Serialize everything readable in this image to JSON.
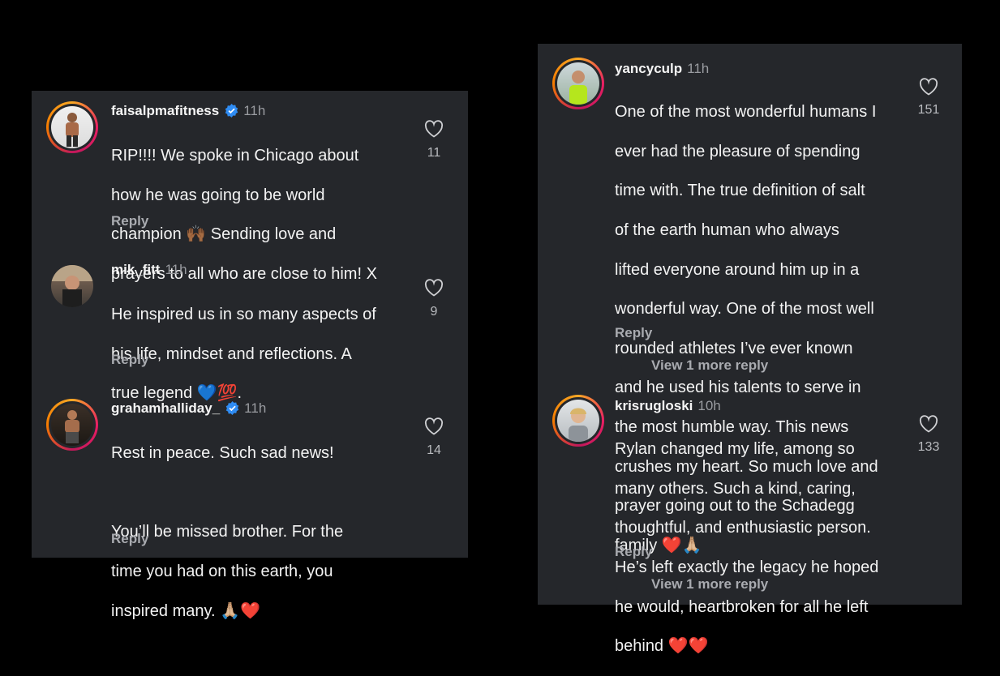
{
  "left_panel": {
    "comments": [
      {
        "username": "faisalpmafitness",
        "verified": true,
        "time": "11h",
        "lines": [
          "RIP!!!! We spoke in Chicago about",
          "how he was going to be world",
          "champion 🙌🏾 Sending love and",
          "prayers to all who are close to him! X"
        ],
        "reply": "Reply",
        "likes": "11"
      },
      {
        "username": "mik_fitt",
        "verified": false,
        "time": "11h",
        "lines": [
          "He inspired us in so many aspects of",
          "his life, mindset and reflections. A",
          "true legend 💙💯."
        ],
        "reply": "Reply",
        "likes": "9"
      },
      {
        "username": "grahamhalliday_",
        "verified": true,
        "time": "11h",
        "lines": [
          "Rest in peace. Such sad news!",
          "",
          "You’ll be missed brother. For the",
          "time you had on this earth, you",
          "inspired many. 🙏🏼❤️"
        ],
        "reply": "Reply",
        "likes": "14"
      }
    ]
  },
  "right_panel": {
    "comments": [
      {
        "username": "yancyculp",
        "verified": false,
        "time": "11h",
        "lines": [
          "One of the most wonderful humans I",
          "ever had the pleasure of spending",
          "time with.  The true definition of salt",
          "of the earth human who always",
          "lifted everyone around him up in a",
          "wonderful way.  One of the most well",
          "rounded athletes I’ve ever known",
          "and he used his talents to serve in",
          "the most humble way.  This news",
          "crushes my heart.  So much love and",
          "prayer going out to the Schadegg",
          "family ❤️🙏🏼"
        ],
        "reply": "Reply",
        "view_more": "View 1 more reply",
        "likes": "151"
      },
      {
        "username": "krisrugloski",
        "verified": false,
        "time": "10h",
        "lines": [
          "Rylan changed my life, among so",
          "many others. Such a kind, caring,",
          "thoughtful, and enthusiastic person.",
          "He’s left exactly the legacy he hoped",
          "he would, heartbroken for all he left",
          "behind ❤️❤️"
        ],
        "reply": "Reply",
        "view_more": "View 1 more reply",
        "likes": "133"
      }
    ]
  },
  "icons": {
    "like": "heart-outline-icon",
    "verified": "verified-badge-icon"
  },
  "colors": {
    "panel_bg": "#25272b",
    "verified_blue": "#2f8cf3",
    "story_ring": "#e91e63"
  }
}
